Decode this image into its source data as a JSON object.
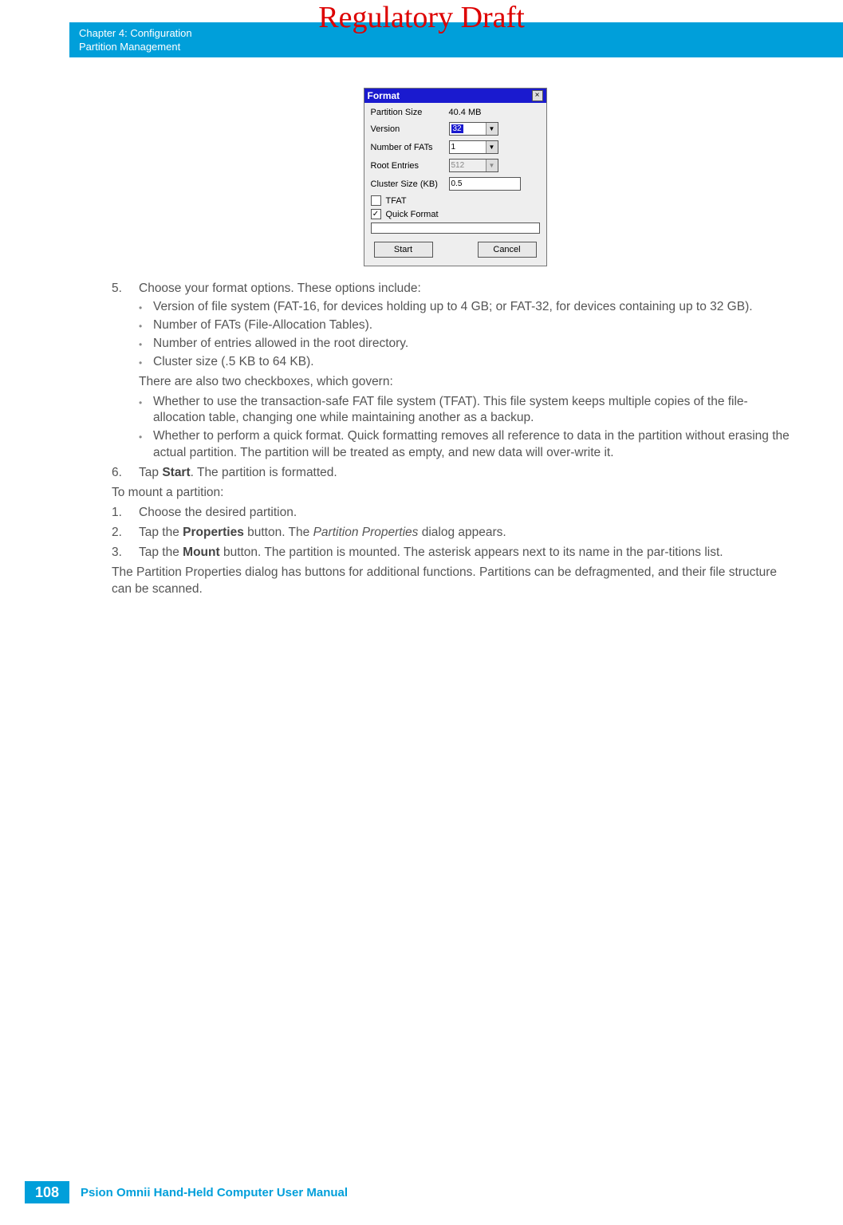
{
  "watermark": "Regulatory Draft",
  "header": {
    "chapter": "Chapter 4:  Configuration",
    "section": "Partition Management"
  },
  "dialog": {
    "title": "Format",
    "partition_size_label": "Partition Size",
    "partition_size_value": "40.4 MB",
    "version_label": "Version",
    "version_value": "32",
    "fats_label": "Number of FATs",
    "fats_value": "1",
    "root_label": "Root Entries",
    "root_value": "512",
    "cluster_label": "Cluster Size (KB)",
    "cluster_value": "0.5",
    "tfat_label": "TFAT",
    "quick_label": "Quick Format",
    "start_btn": "Start",
    "cancel_btn": "Cancel"
  },
  "step5": {
    "num": "5.",
    "lead": "Choose your format options. These options include:",
    "b1": "Version of file system (FAT-16, for devices holding up to 4 GB; or FAT-32, for devices containing up to 32 GB).",
    "b2": "Number of FATs (File-Allocation Tables).",
    "b3": "Number of entries allowed in the root directory.",
    "b4": "Cluster size (.5 KB to 64 KB).",
    "mid": "There are also two checkboxes, which govern:",
    "b5": "Whether to use the transaction-safe FAT file system (TFAT). This file system keeps multiple copies of the file-allocation table, changing one while maintaining another as a backup.",
    "b6": "Whether to perform a quick format. Quick formatting removes all reference to data in the partition without erasing the actual partition. The partition will be treated as empty, and new data will over-write it."
  },
  "step6": {
    "num": "6.",
    "pre": "Tap ",
    "bold": "Start",
    "post": ". The partition is formatted."
  },
  "mount_intro": "To mount a partition:",
  "m1": {
    "num": "1.",
    "text": "Choose the desired partition."
  },
  "m2": {
    "num": "2.",
    "pre": "Tap the ",
    "bold": "Properties",
    "mid": " button. The ",
    "ital": "Partition Properties",
    "post": " dialog appears."
  },
  "m3": {
    "num": "3.",
    "pre": "Tap the ",
    "bold": "Mount",
    "post": " button. The partition is mounted. The asterisk appears next to its name in the par-titions list."
  },
  "closing": "The Partition Properties dialog has buttons for additional functions. Partitions can be defragmented, and their file structure can be scanned.",
  "footer": {
    "page": "108",
    "title": "Psion Omnii Hand-Held Computer User Manual"
  }
}
